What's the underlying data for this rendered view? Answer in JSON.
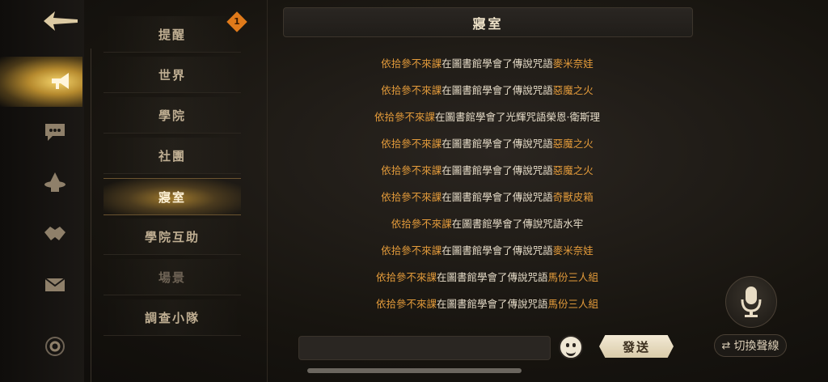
{
  "rail": {
    "icons": [
      "back-arrow-icon",
      "megaphone-icon",
      "chat-bubble-icon",
      "wizard-hat-icon",
      "handshake-icon",
      "mail-icon",
      "settings-icon"
    ]
  },
  "categories": [
    {
      "label": "提醒",
      "state": "normal"
    },
    {
      "label": "世界",
      "state": "normal"
    },
    {
      "label": "學院",
      "state": "normal"
    },
    {
      "label": "社團",
      "state": "normal"
    },
    {
      "label": "寢室",
      "state": "active"
    },
    {
      "label": "學院互助",
      "state": "normal"
    },
    {
      "label": "場景",
      "state": "dim"
    },
    {
      "label": "調查小隊",
      "state": "normal"
    }
  ],
  "badge": {
    "count": "1",
    "color": "#e07a1a"
  },
  "panel": {
    "title": "寢室"
  },
  "messages": [
    {
      "user": "依拾參不來課",
      "text": "在圖書館學會了傳說咒語",
      "spell": "麥米奈娃",
      "spell_color": "orange"
    },
    {
      "user": "依拾參不來課",
      "text": "在圖書館學會了傳說咒語",
      "spell": "惡魔之火",
      "spell_color": "orange"
    },
    {
      "user": "依拾參不來課",
      "text": "在圖書館學會了光輝咒語",
      "spell": "榮恩·衛斯理",
      "spell_color": "white"
    },
    {
      "user": "依拾參不來課",
      "text": "在圖書館學會了傳說咒語",
      "spell": "惡魔之火",
      "spell_color": "orange"
    },
    {
      "user": "依拾參不來課",
      "text": "在圖書館學會了傳說咒語",
      "spell": "惡魔之火",
      "spell_color": "orange"
    },
    {
      "user": "依拾參不來課",
      "text": "在圖書館學會了傳說咒語",
      "spell": "奇獸皮箱",
      "spell_color": "orange"
    },
    {
      "user": "依拾參不來課",
      "text": "在圖書館學會了傳說咒語",
      "spell": "水牢",
      "spell_color": "white"
    },
    {
      "user": "依拾參不來課",
      "text": "在圖書館學會了傳說咒語",
      "spell": "麥米奈娃",
      "spell_color": "orange"
    },
    {
      "user": "依拾參不來課",
      "text": "在圖書館學會了傳說咒語",
      "spell": "馬份三人組",
      "spell_color": "orange"
    },
    {
      "user": "依拾參不來課",
      "text": "在圖書館學會了傳說咒語",
      "spell": "馬份三人組",
      "spell_color": "orange"
    }
  ],
  "input": {
    "value": "",
    "placeholder": ""
  },
  "send_label": "發送",
  "voice_switch_label": "切換聲線",
  "colors": {
    "accent_orange": "#e29a3a",
    "text_light": "#e6dcc8",
    "active_gold": "#f4d46b"
  }
}
